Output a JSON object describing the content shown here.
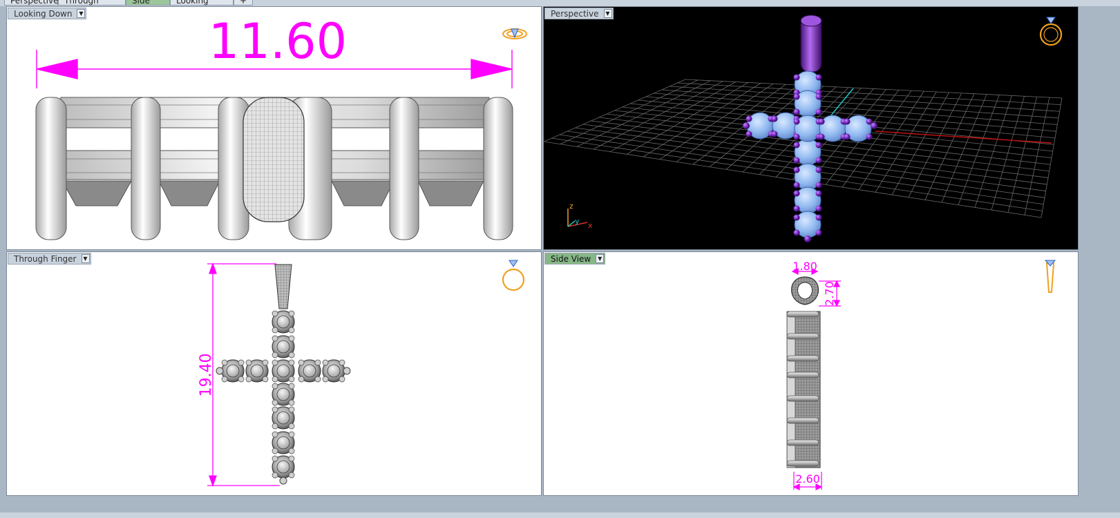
{
  "tabs": [
    "Perspective",
    "Through Finger",
    "Side View",
    "Looking Down",
    "+"
  ],
  "active_tab": 2,
  "viewports": {
    "top_left": {
      "label": "Looking Down",
      "dimension": "11.60",
      "icon": "ring-top-view-icon"
    },
    "top_right": {
      "label": "Perspective",
      "axis_z": "z",
      "axis_y": "y",
      "axis_x": "x",
      "icon": "ring-perspective-icon"
    },
    "bottom_left": {
      "label": "Through Finger",
      "dimension": "19.40",
      "icon": "ring-front-view-icon"
    },
    "bottom_right": {
      "label": "Side View",
      "dim_bail_width": "1.80",
      "dim_bail_height": "2.70",
      "dim_depth": "2.60",
      "icon": "ring-side-view-icon"
    }
  },
  "colors": {
    "dimension": "#ff00ff",
    "stone_blue": "#8fb8f0",
    "metal_purple": "#7a22c8",
    "grid": "#6a6a6a",
    "icon_gold": "#f0a020"
  }
}
